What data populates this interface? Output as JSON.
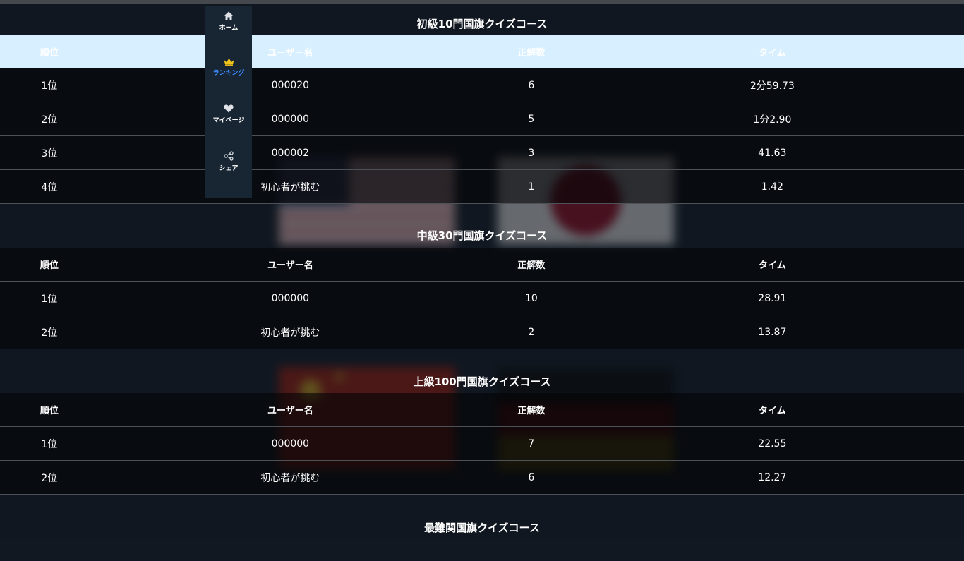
{
  "nav": {
    "items": [
      {
        "label": "ホーム",
        "icon": "home-icon"
      },
      {
        "label": "ランキング",
        "icon": "crown-icon",
        "active": true
      },
      {
        "label": "マイページ",
        "icon": "heart-icon"
      },
      {
        "label": "シェア",
        "icon": "share-icon"
      }
    ],
    "active_color": "#3b8cff"
  },
  "columns": {
    "rank": "順位",
    "user": "ユーザー名",
    "correct": "正解数",
    "time": "タイム"
  },
  "courses": [
    {
      "title": "初級10門国旗クイズコース",
      "rows": [
        {
          "rank": "1位",
          "user": "000020",
          "correct": "6",
          "time": "2分59.73"
        },
        {
          "rank": "2位",
          "user": "000000",
          "correct": "5",
          "time": "1分2.90"
        },
        {
          "rank": "3位",
          "user": "000002",
          "correct": "3",
          "time": "41.63"
        },
        {
          "rank": "4位",
          "user": "初心者が挑む",
          "correct": "1",
          "time": "1.42"
        }
      ]
    },
    {
      "title": "中級30門国旗クイズコース",
      "rows": [
        {
          "rank": "1位",
          "user": "000000",
          "correct": "10",
          "time": "28.91"
        },
        {
          "rank": "2位",
          "user": "初心者が挑む",
          "correct": "2",
          "time": "13.87"
        }
      ]
    },
    {
      "title": "上級100門国旗クイズコース",
      "rows": [
        {
          "rank": "1位",
          "user": "000000",
          "correct": "7",
          "time": "22.55"
        },
        {
          "rank": "2位",
          "user": "初心者が挑む",
          "correct": "6",
          "time": "12.27"
        }
      ]
    },
    {
      "title": "最難関国旗クイズコース",
      "rows": []
    }
  ]
}
